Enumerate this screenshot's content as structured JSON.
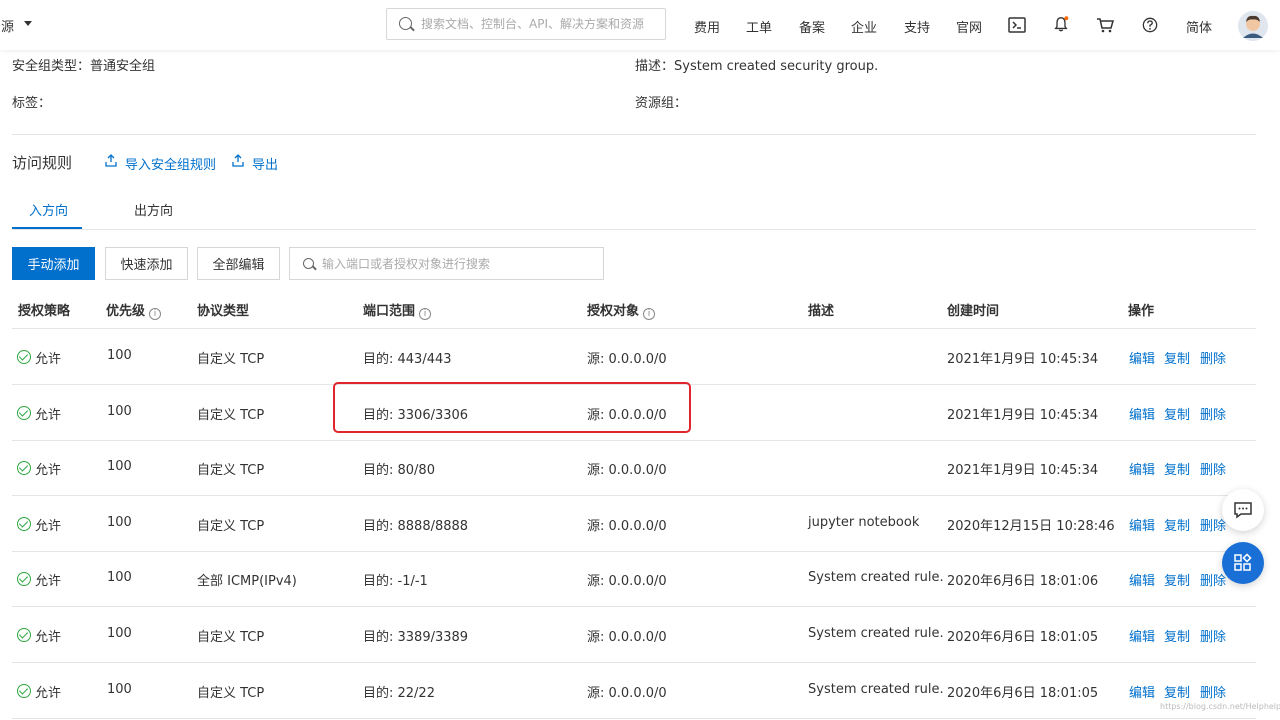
{
  "topbar": {
    "resource_label": "资源",
    "search_placeholder": "搜索文档、控制台、API、解决方案和资源",
    "nav": [
      "费用",
      "工单",
      "备案",
      "企业",
      "支持",
      "官网"
    ],
    "language": "简体",
    "icons": [
      "terminal-icon",
      "bell-icon",
      "cart-icon",
      "help-icon",
      "avatar"
    ]
  },
  "info": {
    "type_label": "安全组类型：",
    "type_value": "普通安全组",
    "desc_label": "描述：",
    "desc_value": "System created security group.",
    "tag_label": "标签：",
    "group_label": "资源组："
  },
  "rules": {
    "title": "访问规则",
    "import_label": "导入安全组规则",
    "export_label": "导出"
  },
  "tabs": [
    "入方向",
    "出方向"
  ],
  "toolbar": {
    "manual_add": "手动添加",
    "quick_add": "快速添加",
    "edit_all": "全部编辑",
    "search_placeholder": "输入端口或者授权对象进行搜索"
  },
  "table": {
    "headers": [
      "授权策略",
      "优先级",
      "协议类型",
      "端口范围",
      "授权对象",
      "描述",
      "创建时间",
      "操作"
    ],
    "rows": [
      {
        "policy": "允许",
        "priority": "100",
        "protocol": "自定义 TCP",
        "port": "目的: 443/443",
        "source": "源: 0.0.0.0/0",
        "desc": "",
        "time": "2021年1月9日 10:45:34"
      },
      {
        "policy": "允许",
        "priority": "100",
        "protocol": "自定义 TCP",
        "port": "目的: 3306/3306",
        "source": "源: 0.0.0.0/0",
        "desc": "",
        "time": "2021年1月9日 10:45:34"
      },
      {
        "policy": "允许",
        "priority": "100",
        "protocol": "自定义 TCP",
        "port": "目的: 80/80",
        "source": "源: 0.0.0.0/0",
        "desc": "",
        "time": "2021年1月9日 10:45:34"
      },
      {
        "policy": "允许",
        "priority": "100",
        "protocol": "自定义 TCP",
        "port": "目的: 8888/8888",
        "source": "源: 0.0.0.0/0",
        "desc": "jupyter notebook",
        "time": "2020年12月15日 10:28:46"
      },
      {
        "policy": "允许",
        "priority": "100",
        "protocol": "全部 ICMP(IPv4)",
        "port": "目的: -1/-1",
        "source": "源: 0.0.0.0/0",
        "desc": "System created rule.",
        "time": "2020年6月6日 18:01:06"
      },
      {
        "policy": "允许",
        "priority": "100",
        "protocol": "自定义 TCP",
        "port": "目的: 3389/3389",
        "source": "源: 0.0.0.0/0",
        "desc": "System created rule.",
        "time": "2020年6月6日 18:01:05"
      },
      {
        "policy": "允许",
        "priority": "100",
        "protocol": "自定义 TCP",
        "port": "目的: 22/22",
        "source": "源: 0.0.0.0/0",
        "desc": "System created rule.",
        "time": "2020年6月6日 18:01:05"
      }
    ],
    "actions": [
      "编辑",
      "复制",
      "删除"
    ]
  },
  "colors": {
    "accent": "#0070cc",
    "allow": "#2fa842",
    "highlight": "#e0262c"
  },
  "watermark": "https://blog.csdn.net/Helphelp"
}
